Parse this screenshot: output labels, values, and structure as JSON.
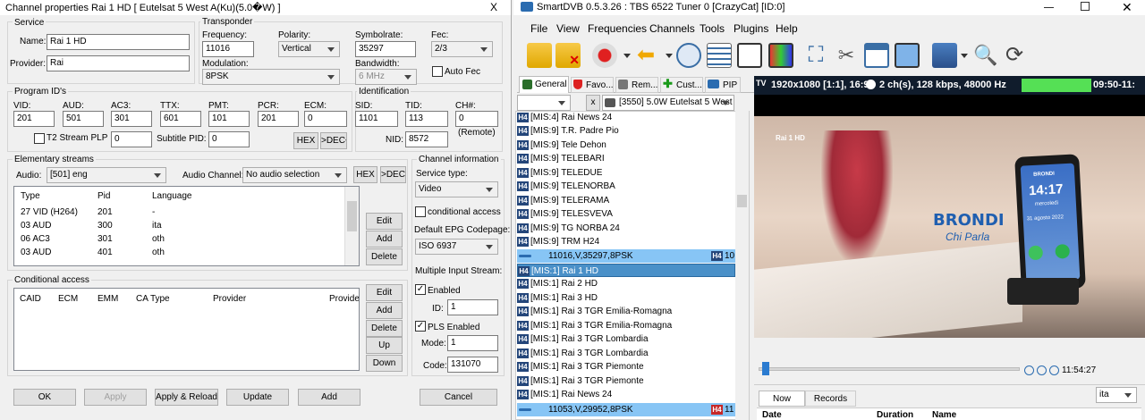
{
  "left": {
    "title": "Channel properties Rai 1 HD [ Eutelsat 5 West A(Ku)(5.0�W) ]",
    "close": "X",
    "service": {
      "group": "Service",
      "name_label": "Name:",
      "name": "Rai 1 HD",
      "provider_label": "Provider:",
      "provider": "Rai"
    },
    "transponder": {
      "group": "Transponder",
      "freq_label": "Frequency:",
      "freq": "11016",
      "pol_label": "Polarity:",
      "pol": "Vertical",
      "sym_label": "Symbolrate:",
      "sym": "35297",
      "fec_label": "Fec:",
      "fec": "2/3",
      "mod_label": "Modulation:",
      "mod": "8PSK",
      "bw_label": "Bandwidth:",
      "bw": "6 MHz",
      "autofec": "Auto Fec"
    },
    "pids": {
      "group": "Program ID's",
      "vid_l": "VID:",
      "vid": "201",
      "aud_l": "AUD:",
      "aud": "501",
      "ac3_l": "AC3:",
      "ac3": "301",
      "ttx_l": "TTX:",
      "ttx": "601",
      "pmt_l": "PMT:",
      "pmt": "101",
      "pcr_l": "PCR:",
      "pcr": "201",
      "ecm_l": "ECM:",
      "ecm": "0",
      "t2": "T2 Stream PLP",
      "t2v": "0",
      "sub_l": "Subtitle PID:",
      "sub": "0",
      "hex": "HEX",
      "dec": ">DEC<"
    },
    "ident": {
      "group": "Identification",
      "sid_l": "SID:",
      "sid": "1101",
      "tid_l": "TID:",
      "tid": "113",
      "ch_l": "CH#:",
      "ch": "0",
      "remote": "(Remote)",
      "nid_l": "NID:",
      "nid": "8572"
    },
    "elem": {
      "group": "Elementary streams",
      "audio_l": "Audio:",
      "audio": "[501] eng",
      "ach_l": "Audio Channel:",
      "ach": "No audio selection",
      "hex": "HEX",
      "dec": ">DEC<",
      "cols": [
        "Type",
        "Pid",
        "Language"
      ],
      "rows": [
        [
          "27 VID (H264)",
          "201",
          "-"
        ],
        [
          "03 AUD",
          "300",
          "ita"
        ],
        [
          "06 AC3",
          "301",
          "oth"
        ],
        [
          "03 AUD",
          "401",
          "oth"
        ]
      ],
      "edit": "Edit",
      "add": "Add",
      "del": "Delete"
    },
    "cond": {
      "group": "Conditional access",
      "cols": [
        "CAID",
        "ECM",
        "EMM",
        "CA Type",
        "Provider",
        "Provider"
      ],
      "edit": "Edit",
      "add": "Add",
      "del": "Delete",
      "up": "Up",
      "down": "Down"
    },
    "chinfo": {
      "group": "Channel information",
      "stype_l": "Service type:",
      "stype": "Video",
      "condacc": "conditional access",
      "epg_l": "Default EPG Codepage:",
      "epg": "ISO 6937",
      "mis_l": "Multiple Input Stream:",
      "enabled": "Enabled",
      "id_l": "ID:",
      "id": "1",
      "pls": "PLS Enabled",
      "mode_l": "Mode:",
      "mode": "1",
      "code_l": "Code:",
      "code": "131070"
    },
    "footer": {
      "ok": "OK",
      "apply": "Apply",
      "applyreload": "Apply & Reload",
      "update": "Update",
      "add": "Add",
      "cancel": "Cancel"
    }
  },
  "right": {
    "title": "SmartDVB 0.5.3.26 : TBS 6522 Tuner 0 [CrazyCat] [ID:0]",
    "menu": [
      "File",
      "View",
      "Frequencies",
      "Channels",
      "Tools",
      "Plugins",
      "Help"
    ],
    "tabs": [
      "General",
      "Favo...",
      "Rem...",
      "Cust...",
      "PIP"
    ],
    "sat": "[3550]  5.0W  Eutelsat 5 West",
    "close": "x",
    "channels": [
      "[MIS:4] Rai News 24",
      "[MIS:9] T.R. Padre Pio",
      "[MIS:9] Tele Dehon",
      "[MIS:9] TELEBARI",
      "[MIS:9] TELEDUE",
      "[MIS:9] TELENORBA",
      "[MIS:9] TELERAMA",
      "[MIS:9] TELESVEVA",
      "[MIS:9] TG NORBA 24",
      "[MIS:9] TRM H24"
    ],
    "tp1": "11016,V,35297,8PSK",
    "tp1_tag": "H4",
    "tp1_count": "10",
    "channels2": [
      "[MIS:1] Rai 1 HD",
      "[MIS:1] Rai 2 HD",
      "[MIS:1] Rai 3 HD",
      "[MIS:1] Rai 3 TGR Emilia-Romagna",
      "[MIS:1] Rai 3 TGR Emilia-Romagna",
      "[MIS:1] Rai 3 TGR Lombardia",
      "[MIS:1] Rai 3 TGR Lombardia",
      "[MIS:1] Rai 3 TGR Piemonte",
      "[MIS:1] Rai 3 TGR Piemonte",
      "[MIS:1] Rai News 24"
    ],
    "tp2": "11053,V,29952,8PSK",
    "tp2_tag": "H4",
    "tp2_count": "11",
    "h4": "H4",
    "status": {
      "tv": "TV",
      "res": "1920x1080 [1:1], 16:9",
      "audio": "2 ch(s), 128 kbps, 48000 Hz",
      "time": "09:50-11:"
    },
    "video": {
      "logo": "Rai 1 HD",
      "brand": "BRONDI",
      "tagline": "Chi Parla",
      "clock": "14:17",
      "day": "mercoledì",
      "date": "31 agosto 2022",
      "phonebrand": "BRONDI"
    },
    "seek_time": "11:54:27",
    "epg": {
      "now": "Now",
      "records": "Records",
      "lang": "ita",
      "cols": [
        "Date",
        "Duration",
        "Name"
      ]
    }
  }
}
